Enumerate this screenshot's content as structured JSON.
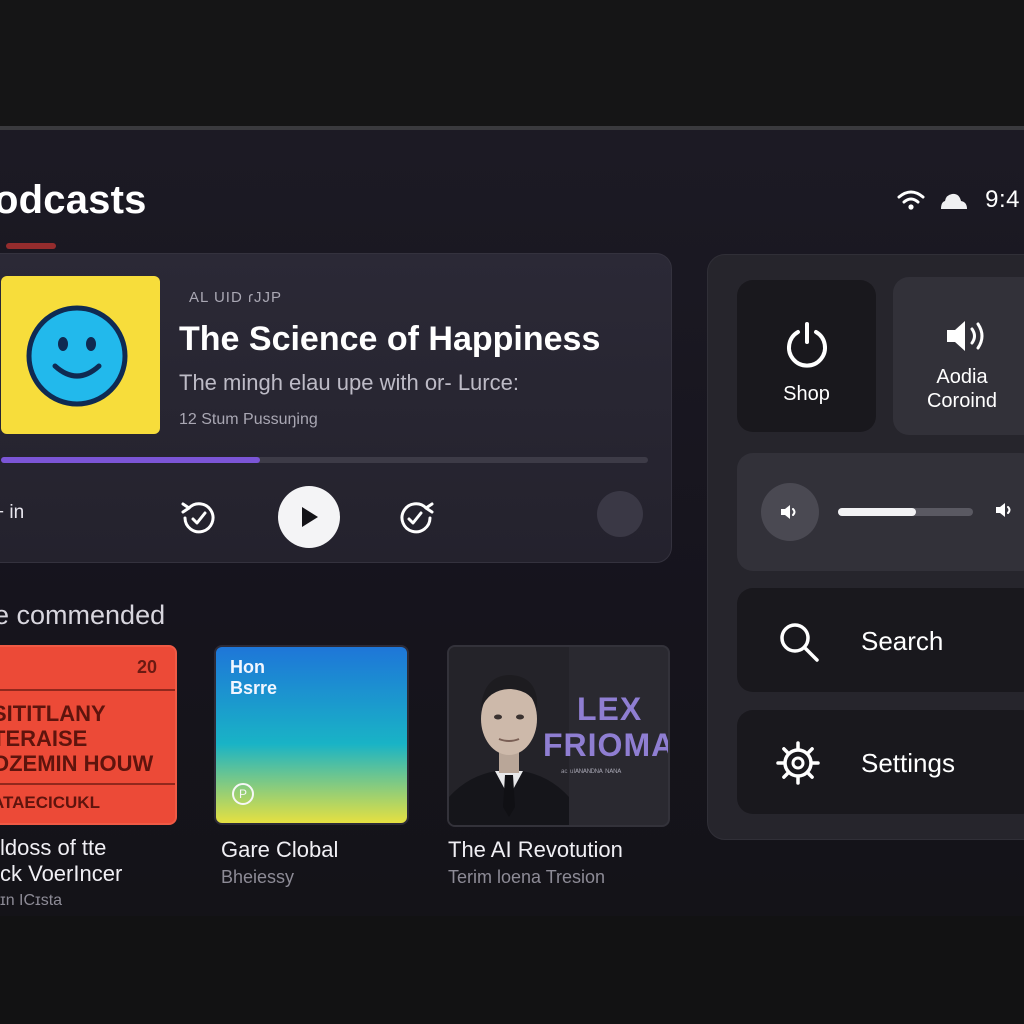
{
  "header": {
    "title": "odcasts",
    "time": "9:4"
  },
  "now_playing": {
    "kicker": "AL UID ɾJJP",
    "title": "The Science of Happiness",
    "description": "The mingh elau upe with or- Lurce:",
    "meta": "12 Stum Pussuŋing",
    "progress_fraction": 0.4,
    "control_label": "+ in",
    "icons": {
      "artwork": "smiley-face-icon",
      "rewind": "rewind-icon",
      "play": "play-icon",
      "forward": "fast-forward-icon"
    }
  },
  "recommended": {
    "title": "e commended",
    "items": [
      {
        "cover_badge": "20",
        "cover_text": [
          "SITITLANY",
          "TERAISE",
          "OZEMIN HOUW"
        ],
        "cover_footer": "ATAECICUKL",
        "name_lines": [
          "ldoss of tte",
          "ck VoerIncer"
        ],
        "sub": "ɪn ICɪsta"
      },
      {
        "cover_text": [
          "Hon",
          "Bsrre"
        ],
        "name_lines": [
          "Gare Clobal"
        ],
        "sub": "Bheiessy"
      },
      {
        "cover_text": [
          "LEX",
          "FRIOMAN"
        ],
        "cover_sub": "ᵃᶜ ᵘᴵᴬᴺᴬᴺᴰᴺᴬ ᴺᴬᴺᴬ",
        "name_lines": [
          "The AI Revotution"
        ],
        "sub": "Terim loena Tresion"
      }
    ]
  },
  "panel": {
    "shop_label": "Shop",
    "audio_label": [
      "Aodia",
      "Coroind"
    ],
    "volume_fraction": 0.58,
    "search_label": "Search",
    "settings_label": "Settings",
    "icons": {
      "shop": "power-icon",
      "audio": "speaker-icon",
      "volume_low": "volume-low-icon",
      "volume_high": "volume-high-icon",
      "search": "search-icon",
      "settings": "gear-icon"
    }
  },
  "colors": {
    "accent": "#7b55d6",
    "artwork_yellow": "#f7dd3b",
    "smiley_blue": "#22b9ec",
    "rec_red": "#ec4a37"
  }
}
